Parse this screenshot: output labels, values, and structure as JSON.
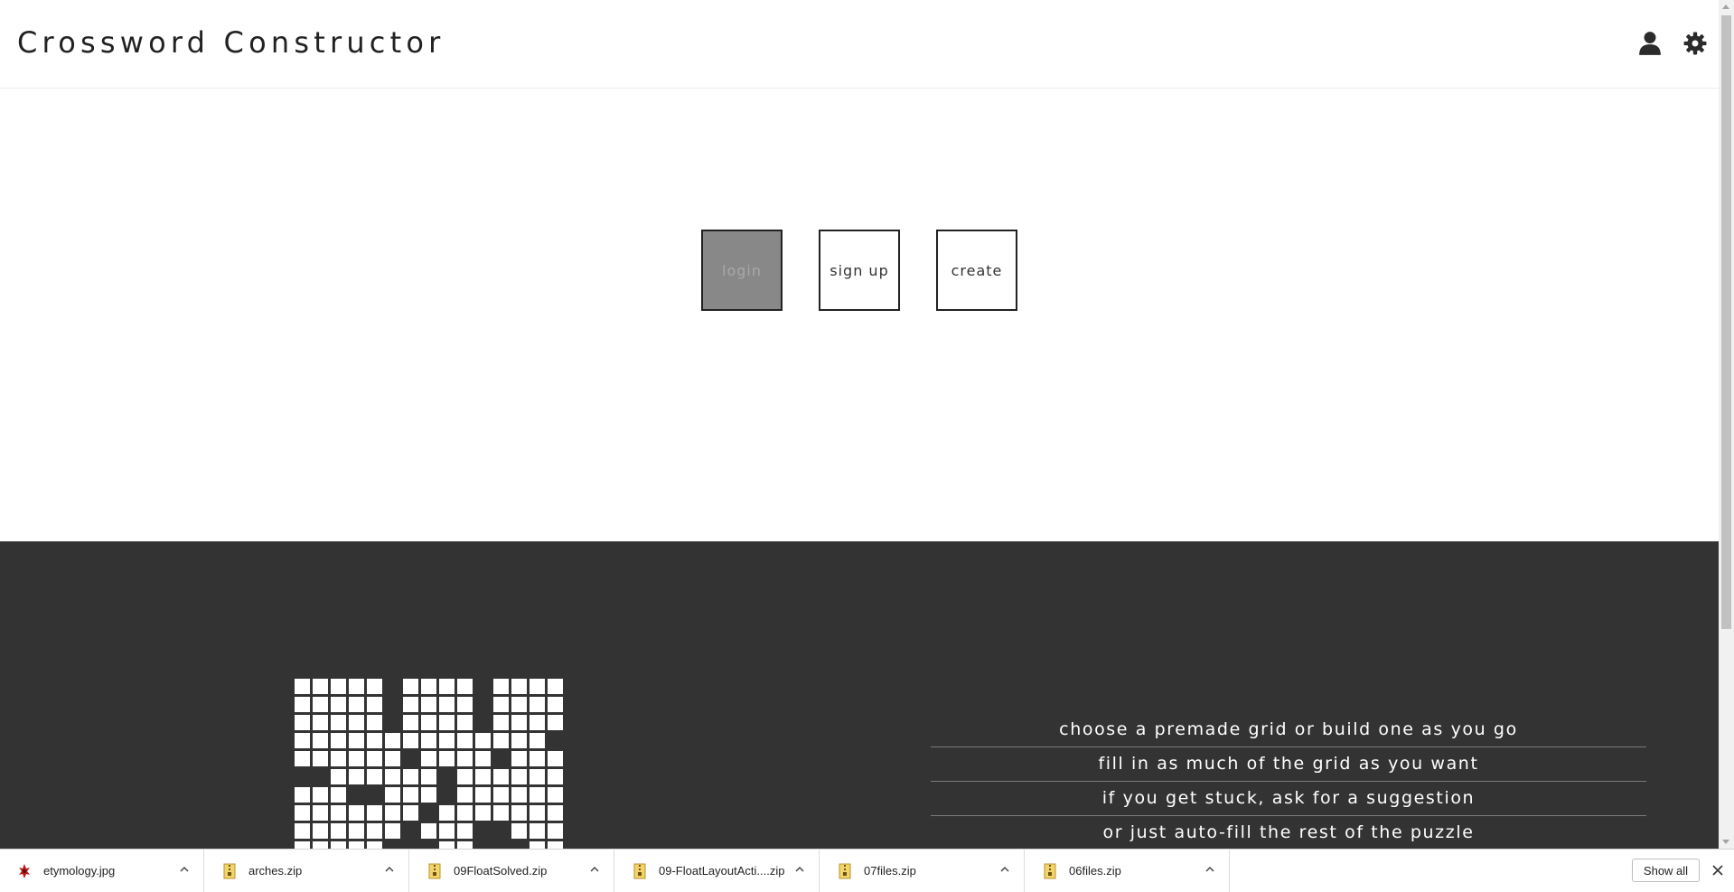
{
  "header": {
    "title": "Crossword Constructor",
    "icons": [
      "user-icon",
      "gear-icon"
    ]
  },
  "main": {
    "buttons": [
      {
        "label": "login",
        "state": "active"
      },
      {
        "label": "sign up",
        "state": "normal"
      },
      {
        "label": "create",
        "state": "normal"
      }
    ]
  },
  "features": [
    "choose a premade grid or build one as you go",
    "fill in as much of the grid as you want",
    "if you get stuck, ask for a suggestion",
    "or just auto-fill the rest of the puzzle"
  ],
  "grid_preview": {
    "cols": 15,
    "rows": 10,
    "black_cells": [
      [
        0,
        5
      ],
      [
        0,
        10
      ],
      [
        1,
        5
      ],
      [
        1,
        10
      ],
      [
        2,
        5
      ],
      [
        2,
        10
      ],
      [
        3,
        14
      ],
      [
        4,
        6
      ],
      [
        4,
        11
      ],
      [
        5,
        0
      ],
      [
        5,
        1
      ],
      [
        5,
        8
      ],
      [
        6,
        3
      ],
      [
        6,
        4
      ],
      [
        6,
        8
      ],
      [
        7,
        7
      ],
      [
        8,
        6
      ],
      [
        8,
        10
      ],
      [
        8,
        11
      ],
      [
        9,
        5
      ],
      [
        9,
        6
      ],
      [
        9,
        7
      ],
      [
        9,
        10
      ],
      [
        9,
        11
      ],
      [
        9,
        12
      ]
    ]
  },
  "downloads": {
    "items": [
      {
        "name": "etymology.jpg",
        "icon": "image-file-icon"
      },
      {
        "name": "arches.zip",
        "icon": "zip-file-icon"
      },
      {
        "name": "09FloatSolved.zip",
        "icon": "zip-file-icon"
      },
      {
        "name": "09-FloatLayoutActi....zip",
        "icon": "zip-file-icon"
      },
      {
        "name": "07files.zip",
        "icon": "zip-file-icon"
      },
      {
        "name": "06files.zip",
        "icon": "zip-file-icon"
      }
    ],
    "show_all": "Show all"
  },
  "colors": {
    "dark_section": "#333333",
    "active_button": "#888888",
    "text": "#222222"
  }
}
